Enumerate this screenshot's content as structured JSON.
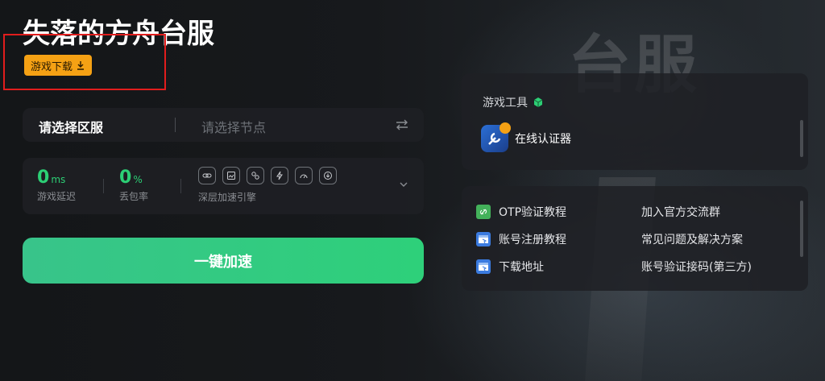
{
  "app_title": "失落的方舟台服",
  "background_text": "台服",
  "download_button": {
    "label": "游戏下载"
  },
  "region": {
    "label": "请选择区服",
    "placeholder": "请选择节点"
  },
  "stats": {
    "latency": {
      "value": "0",
      "unit": "ms",
      "label": "游戏延迟"
    },
    "packet_loss": {
      "value": "0",
      "unit": "%",
      "label": "丢包率"
    },
    "engine_label": "深层加速引擎",
    "engine_icons": [
      "link-icon",
      "image-icon",
      "share-icon",
      "bolt-icon",
      "speed-icon",
      "download-icon"
    ]
  },
  "accelerate_button": {
    "label": "一键加速"
  },
  "tools": {
    "header": "游戏工具",
    "items": [
      {
        "label": "在线认证器",
        "icon": "authenticator-icon"
      }
    ]
  },
  "links": {
    "left": [
      {
        "label": "OTP验证教程",
        "icon": "link-icon",
        "color": "#43b15a"
      },
      {
        "label": "账号注册教程",
        "icon": "www-icon",
        "color": "#3b7be0"
      },
      {
        "label": "下载地址",
        "icon": "www-icon",
        "color": "#3b7be0"
      }
    ],
    "right": [
      {
        "label": "加入官方交流群"
      },
      {
        "label": "常见问题及解决方案"
      },
      {
        "label": "账号验证接码(第三方)"
      }
    ]
  },
  "colors": {
    "accent_green": "#2ccf75",
    "accent_orange": "#f5a114",
    "highlight_red": "#e11d1d"
  }
}
